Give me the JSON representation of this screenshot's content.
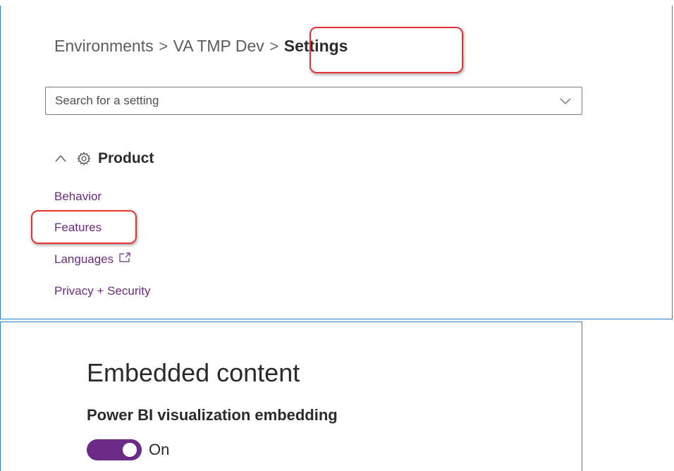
{
  "header_fragment": {
    "link_text": ""
  },
  "breadcrumb": {
    "items": [
      "Environments",
      "VA TMP Dev",
      "Settings"
    ],
    "separator": ">"
  },
  "search": {
    "placeholder": "Search for a setting"
  },
  "product_section": {
    "title": "Product",
    "links": [
      {
        "label": "Behavior"
      },
      {
        "label": "Features"
      },
      {
        "label": "Languages"
      },
      {
        "label": "Privacy + Security"
      }
    ]
  },
  "embedded_content": {
    "title": "Embedded content",
    "setting_label": "Power BI visualization embedding",
    "toggle_state": "On"
  },
  "colors": {
    "link_purple": "#6b2c7f",
    "toggle_purple": "#6b2a86",
    "highlight_red": "#e23232",
    "panel_border_blue": "#2e7dc6"
  },
  "icons": {
    "collapse": "chevron-up-icon",
    "product": "gear-icon",
    "dropdown": "chevron-down-icon",
    "external": "external-link-icon"
  }
}
